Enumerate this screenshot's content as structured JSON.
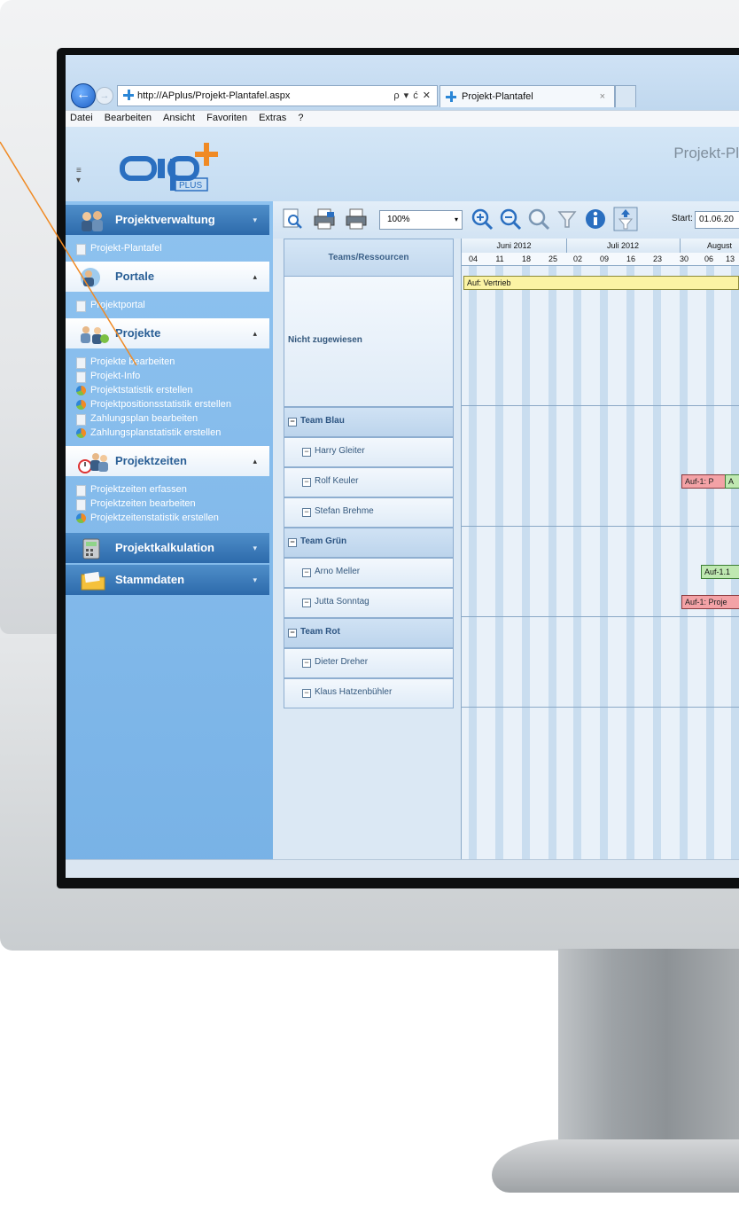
{
  "browser": {
    "url": "http://APplus/Projekt-Plantafel.aspx",
    "address_controls": "ρ ▾ ć ✕",
    "tab_label": "Projekt-Plantafel",
    "tab_close": "×",
    "menu": [
      "Datei",
      "Bearbeiten",
      "Ansicht",
      "Favoriten",
      "Extras",
      "?"
    ]
  },
  "app": {
    "title": "Projekt-Pl",
    "logo_text": "PLUS"
  },
  "sidebar": {
    "sections": [
      {
        "label": "Projektverwaltung",
        "style": "dark",
        "caret": "▾",
        "icon": "users-icon",
        "items": [
          {
            "label": "Projekt-Plantafel",
            "icon": "document-icon"
          }
        ]
      },
      {
        "label": "Portale",
        "style": "light",
        "caret": "▴",
        "icon": "portal-users-icon",
        "items": [
          {
            "label": "Projektportal",
            "icon": "document-icon"
          }
        ]
      },
      {
        "label": "Projekte",
        "style": "light",
        "caret": "▴",
        "icon": "projects-icon",
        "items": [
          {
            "label": "Projekte bearbeiten",
            "icon": "document-icon"
          },
          {
            "label": "Projekt-Info",
            "icon": "document-icon"
          },
          {
            "label": "Projektstatistik erstellen",
            "icon": "pie-chart-icon"
          },
          {
            "label": "Projektpositionsstatistik erstellen",
            "icon": "pie-chart-icon"
          },
          {
            "label": "Zahlungsplan bearbeiten",
            "icon": "document-icon"
          },
          {
            "label": "Zahlungsplanstatistik erstellen",
            "icon": "pie-chart-icon"
          }
        ]
      },
      {
        "label": "Projektzeiten",
        "style": "light",
        "caret": "▴",
        "icon": "clock-users-icon",
        "items": [
          {
            "label": "Projektzeiten erfassen",
            "icon": "document-icon"
          },
          {
            "label": "Projektzeiten bearbeiten",
            "icon": "document-icon"
          },
          {
            "label": "Projektzeitenstatistik erstellen",
            "icon": "pie-chart-icon"
          }
        ]
      },
      {
        "label": "Projektkalkulation",
        "style": "dark",
        "caret": "▾",
        "icon": "calculator-icon",
        "items": []
      },
      {
        "label": "Stammdaten",
        "style": "dark",
        "caret": "▾",
        "icon": "folder-icon",
        "items": []
      }
    ]
  },
  "toolbar": {
    "zoom": "100%",
    "zoom_dropdown": "▾",
    "start_label": "Start:",
    "start_value": "01.06.20"
  },
  "gantt": {
    "resources_header": "Teams/Ressourcen",
    "months": [
      "Juni 2012",
      "Juli 2012",
      "August"
    ],
    "weeks": [
      "04",
      "11",
      "18",
      "25",
      "02",
      "09",
      "16",
      "23",
      "30",
      "06",
      "13"
    ],
    "rows": [
      {
        "label": "Nicht zugewiesen",
        "kind": "unassigned"
      },
      {
        "label": "Team Blau",
        "kind": "team"
      },
      {
        "label": "Harry Gleiter",
        "kind": "person"
      },
      {
        "label": "Rolf Keuler",
        "kind": "person"
      },
      {
        "label": "Stefan Brehme",
        "kind": "person"
      },
      {
        "label": "Team Grün",
        "kind": "team"
      },
      {
        "label": "Arno Meller",
        "kind": "person"
      },
      {
        "label": "Jutta Sonntag",
        "kind": "person"
      },
      {
        "label": "Team Rot",
        "kind": "team"
      },
      {
        "label": "Dieter Dreher",
        "kind": "person"
      },
      {
        "label": "Klaus Hatzenbühler",
        "kind": "person"
      }
    ],
    "bars": [
      {
        "label": "Auf: Vertrieb",
        "color": "yellow"
      },
      {
        "label": "Auf-1: P",
        "color": "pink"
      },
      {
        "label": "A",
        "color": "green"
      },
      {
        "label": "Auf-1.1",
        "color": "green"
      },
      {
        "label": "Auf-1: Proje",
        "color": "pink"
      }
    ],
    "toggle_symbol": "−"
  },
  "colors": {
    "sidebar_bg": "#8ec2ef",
    "section_dark": "#2d6aab",
    "bar_yellow": "#fbf3a4",
    "bar_pink": "#f3a2a6",
    "bar_green": "#bfe8b1",
    "callout_line": "#f08a24"
  }
}
